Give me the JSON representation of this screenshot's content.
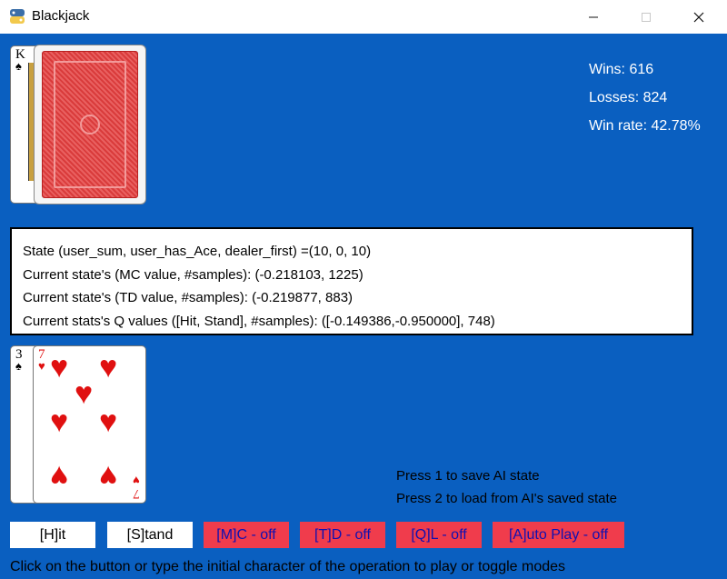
{
  "window": {
    "title": "Blackjack",
    "app_icon": "python-icon",
    "minimize_icon": "minimize-icon",
    "maximize_icon": "maximize-icon",
    "close_icon": "close-icon"
  },
  "colors": {
    "table": "#0a5fc0",
    "button_off": "#f03c4c",
    "button_off_text": "#1010b0"
  },
  "dealer": {
    "cards": [
      {
        "rank": "K",
        "suit": "♠",
        "face": "up"
      },
      {
        "face": "down"
      }
    ]
  },
  "stats": {
    "wins": "Wins: 616",
    "losses": "Losses: 824",
    "win_rate": "Win rate: 42.78%"
  },
  "info": {
    "state": "State (user_sum, user_has_Ace, dealer_first) =(10, 0, 10)",
    "mc": "Current state's (MC value, #samples): (-0.218103, 1225)",
    "td": "Current state's (TD value, #samples): (-0.219877, 883)",
    "q": "Current stats's Q values ([Hit, Stand], #samples): ([-0.149386,-0.950000], 748)"
  },
  "player": {
    "cards": [
      {
        "rank": "3",
        "suit": "♠"
      },
      {
        "rank": "7",
        "suit": "♥"
      }
    ]
  },
  "hints": {
    "save": "Press 1 to save AI state",
    "load": "Press 2 to load from AI's saved state"
  },
  "buttons": {
    "hit": "[H]it",
    "stand": "[S]tand",
    "mc": "[M]C - off",
    "td": "[T]D - off",
    "ql": "[Q]L - off",
    "auto": "[A]uto Play - off"
  },
  "footer": "Click on the button or type the initial character of the operation to play or toggle modes"
}
